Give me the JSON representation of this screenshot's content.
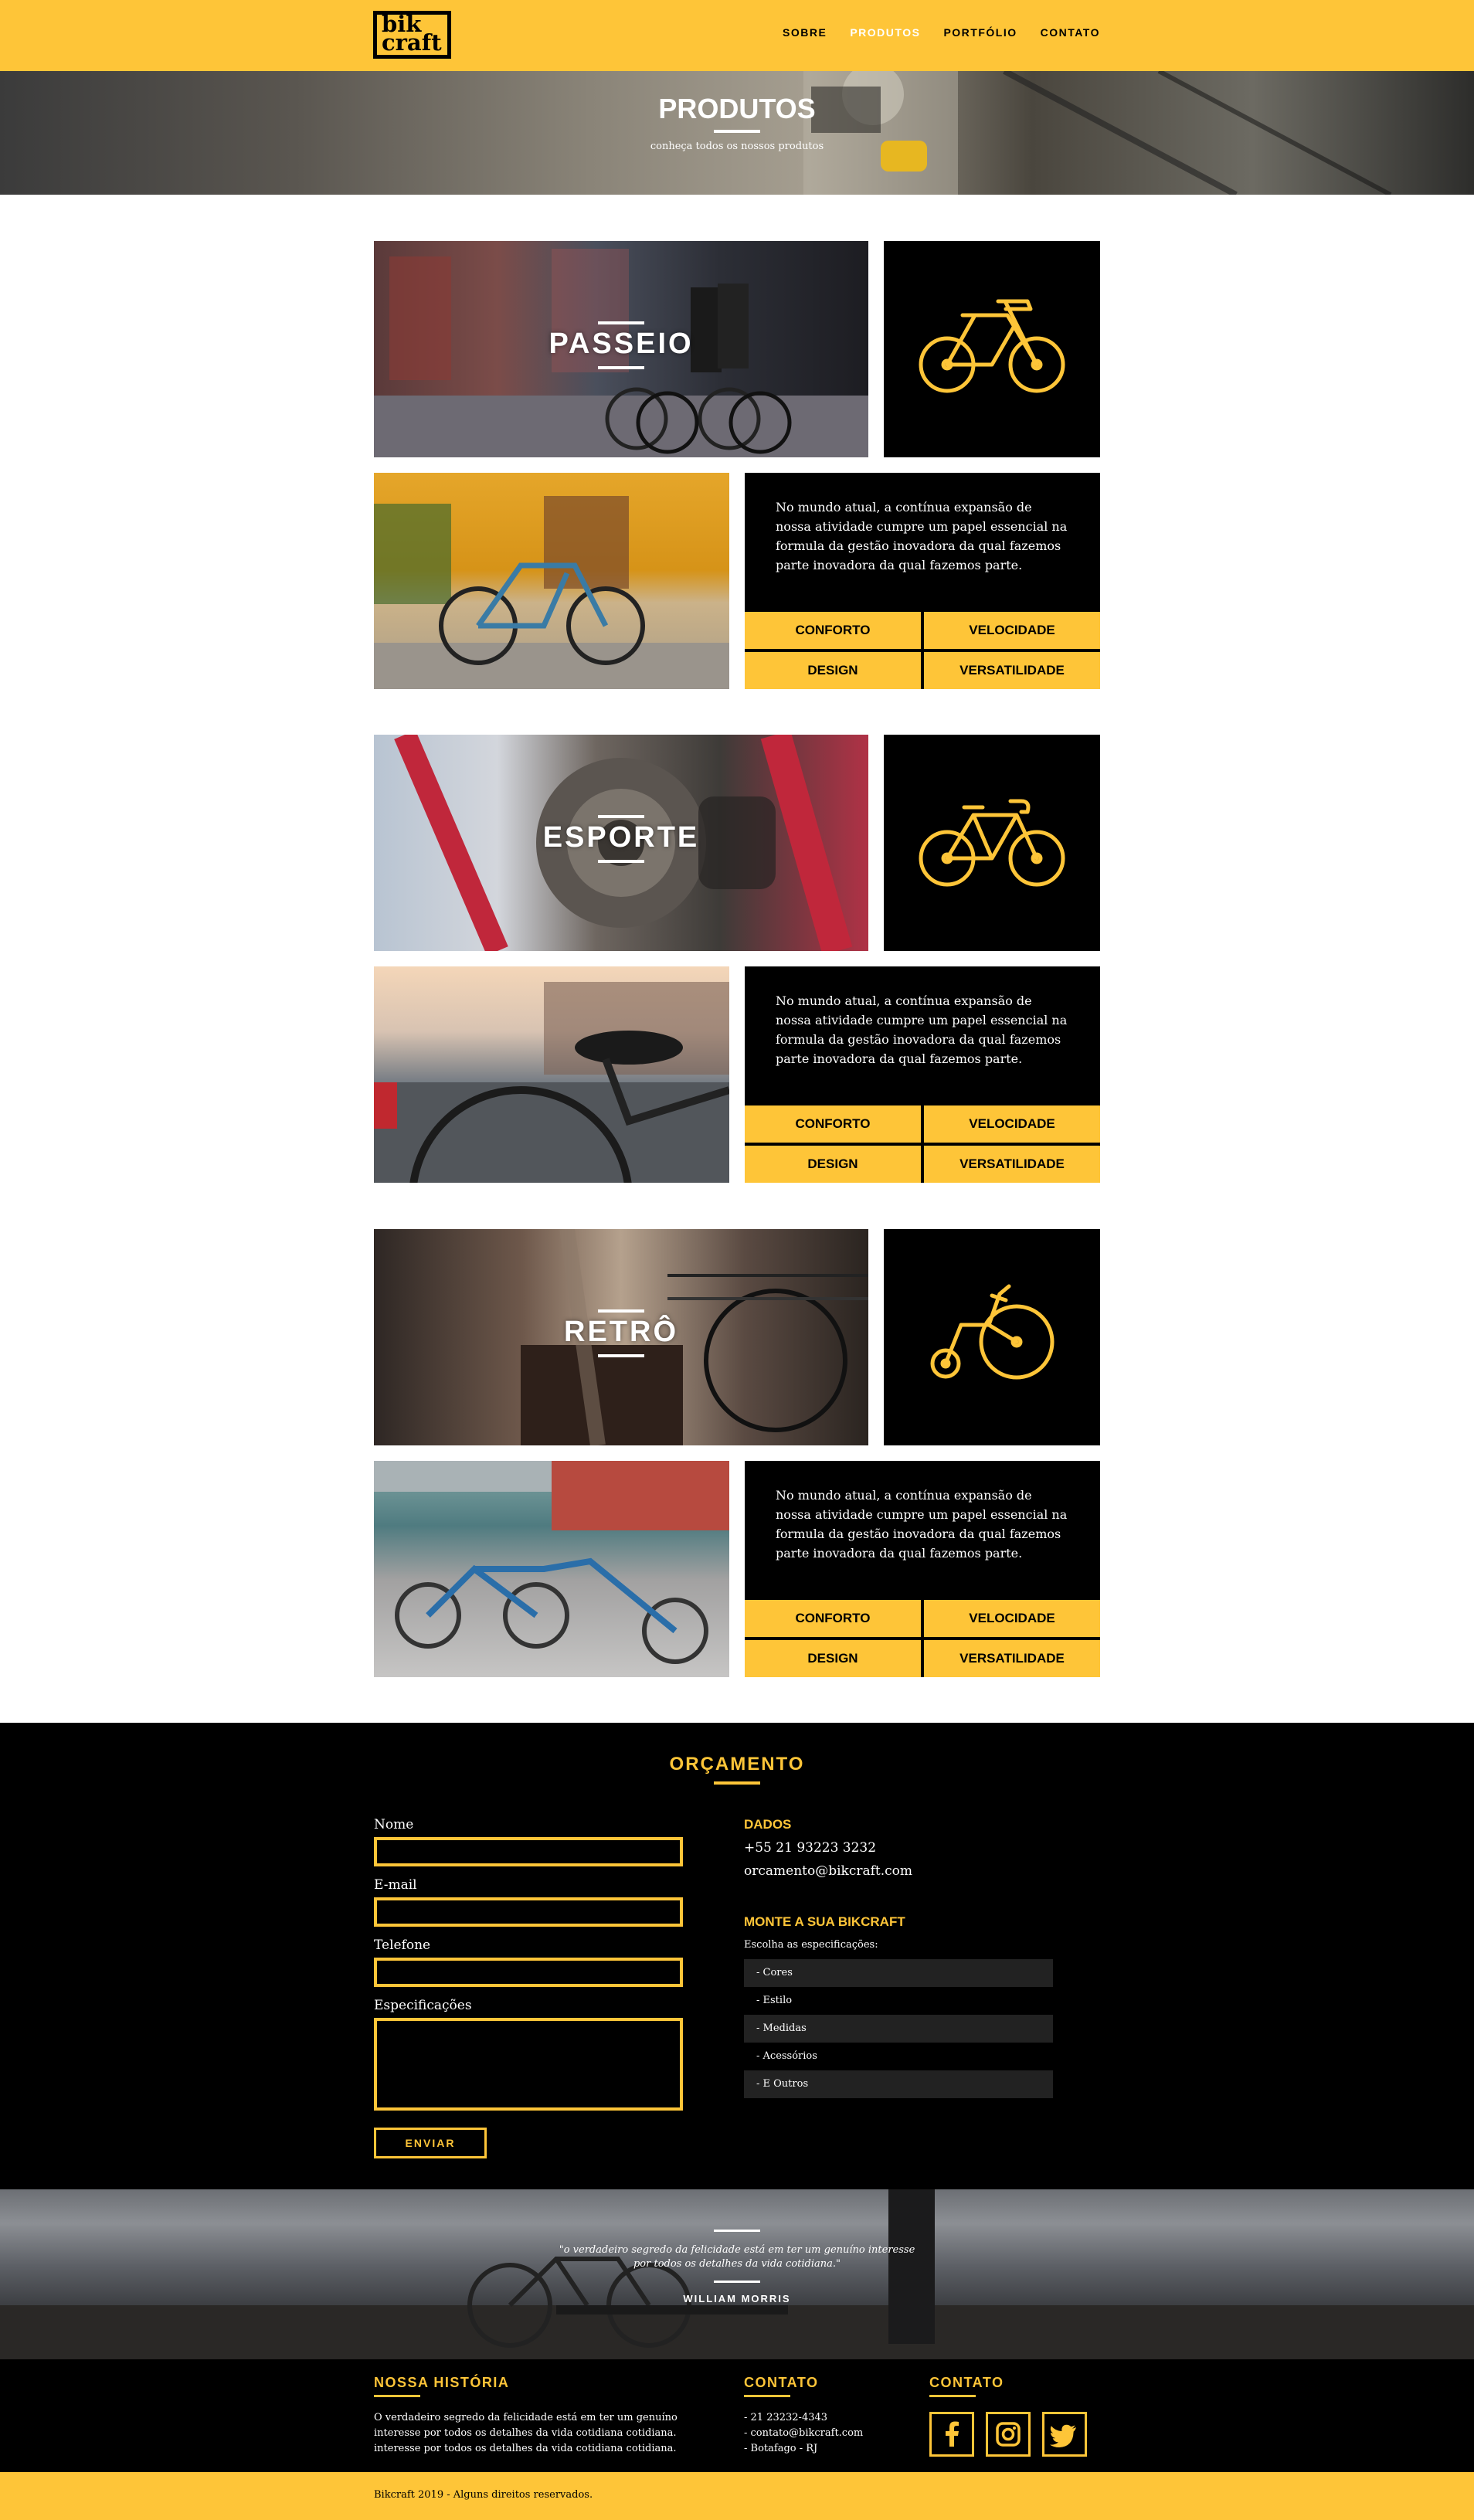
{
  "header": {
    "logo_line1": "bik",
    "logo_line2": "craft",
    "nav": [
      "SOBRE",
      "PRODUTOS",
      "PORTFÓLIO",
      "CONTATO"
    ],
    "active_nav": "PRODUTOS"
  },
  "banner": {
    "title": "PRODUTOS",
    "subtitle": "conheça todos os nossos produtos"
  },
  "products": [
    {
      "title": "PASSEIO",
      "icon": "city-bike-icon",
      "description": "No mundo atual, a contínua expansão de nossa atividade cumpre um papel essencial na formula da gestão inovadora da qual fazemos parte inovadora da qual fazemos parte.",
      "features": [
        "CONFORTO",
        "VELOCIDADE",
        "DESIGN",
        "VERSATILIDADE"
      ]
    },
    {
      "title": "ESPORTE",
      "icon": "sport-bike-icon",
      "description": "No mundo atual, a contínua expansão de nossa atividade cumpre um papel essencial na formula da gestão inovadora da qual fazemos parte inovadora da qual fazemos parte.",
      "features": [
        "CONFORTO",
        "VELOCIDADE",
        "DESIGN",
        "VERSATILIDADE"
      ]
    },
    {
      "title": "RETRÔ",
      "icon": "penny-farthing-icon",
      "description": "No mundo atual, a contínua expansão de nossa atividade cumpre um papel essencial na formula da gestão inovadora da qual fazemos parte inovadora da qual fazemos parte.",
      "features": [
        "CONFORTO",
        "VELOCIDADE",
        "DESIGN",
        "VERSATILIDADE"
      ]
    }
  ],
  "orcamento": {
    "title": "ORÇAMENTO",
    "fields": {
      "nome": "Nome",
      "email": "E-mail",
      "telefone": "Telefone",
      "especificacoes": "Especificações"
    },
    "submit": "ENVIAR",
    "dados_title": "DADOS",
    "phone": "+55 21 93223 3232",
    "email": "orcamento@bikcraft.com",
    "monte_title": "MONTE A SUA BIKCRAFT",
    "monte_sub": "Escolha as especificações:",
    "specs": [
      "- Cores",
      "- Estilo",
      "- Medidas",
      "- Acessórios",
      "- E Outros"
    ]
  },
  "quote": {
    "text_line1": "\"o verdadeiro segredo da felicidade está em ter um genuíno interesse",
    "text_line2": "por todos os detalhes da vida cotidiana.\"",
    "author": "WILLIAM MORRIS"
  },
  "footer": {
    "historia_title": "NOSSA HISTÓRIA",
    "historia_text": "O verdadeiro segredo da felicidade está em ter um genuíno interesse por todos os detalhes da vida cotidiana cotidiana. interesse por todos os detalhes da vida cotidiana cotidiana.",
    "contato_title": "CONTATO",
    "contato_lines": [
      "- 21 23232-4343",
      "- contato@bikcraft.com",
      "- Botafago - RJ"
    ],
    "social_title": "CONTATO",
    "social_icons": [
      "facebook-icon",
      "instagram-icon",
      "twitter-icon"
    ],
    "copyright": "Bikcraft 2019 - Alguns direitos reservados."
  },
  "colors": {
    "brand_yellow": "#fec538",
    "black": "#000000",
    "white": "#ffffff"
  }
}
